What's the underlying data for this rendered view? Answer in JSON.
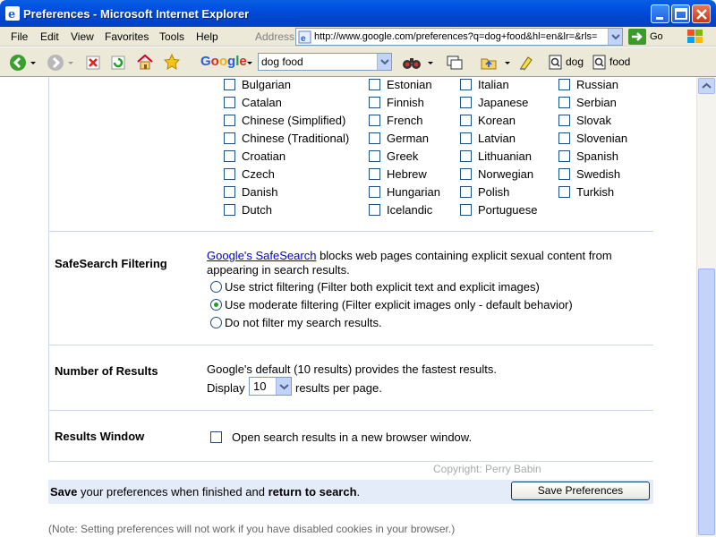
{
  "window": {
    "title": "Preferences - Microsoft Internet Explorer"
  },
  "menubar": {
    "items": [
      "File",
      "Edit",
      "View",
      "Favorites",
      "Tools",
      "Help"
    ],
    "address_label": "Address",
    "url": "http://www.google.com/preferences?q=dog+food&hl=en&lr=&rls=",
    "go_label": "Go"
  },
  "toolbar": {
    "google_logo": "Google",
    "search_value": "dog food",
    "word1": "dog",
    "word2": "food"
  },
  "languages": {
    "col1": [
      "Bulgarian",
      "Catalan",
      "Chinese (Simplified)",
      "Chinese (Traditional)",
      "Croatian",
      "Czech",
      "Danish",
      "Dutch"
    ],
    "col2": [
      "Estonian",
      "Finnish",
      "French",
      "German",
      "Greek",
      "Hebrew",
      "Hungarian",
      "Icelandic"
    ],
    "col3": [
      "Italian",
      "Japanese",
      "Korean",
      "Latvian",
      "Lithuanian",
      "Norwegian",
      "Polish",
      "Portuguese"
    ],
    "col4": [
      "Russian",
      "Serbian",
      "Slovak",
      "Slovenian",
      "Spanish",
      "Swedish",
      "Turkish"
    ]
  },
  "safesearch": {
    "title": "SafeSearch Filtering",
    "link": "Google's SafeSearch",
    "desc1": " blocks web pages containing explicit sexual content from",
    "desc2": "appearing in search results.",
    "options": [
      "Use strict filtering (Filter both explicit text and explicit images)",
      "Use moderate filtering (Filter explicit images only - default behavior)",
      "Do not filter my search results."
    ],
    "selected": 1
  },
  "results": {
    "title": "Number of Results",
    "desc": "Google's default (10 results) provides the fastest results.",
    "display_label": "Display",
    "value": "10",
    "suffix": "results per page."
  },
  "results_window": {
    "title": "Results Window",
    "option": "Open search results in a new browser window."
  },
  "footer": {
    "copyright": "Copyright: Perry Babin",
    "save_bold": "Save",
    "save_mid": " your preferences when finished and ",
    "return_bold": "return to search",
    "period": ".",
    "save_button": "Save Preferences",
    "note": "(Note: Setting preferences will not work if you have disabled cookies in your browser.)"
  }
}
